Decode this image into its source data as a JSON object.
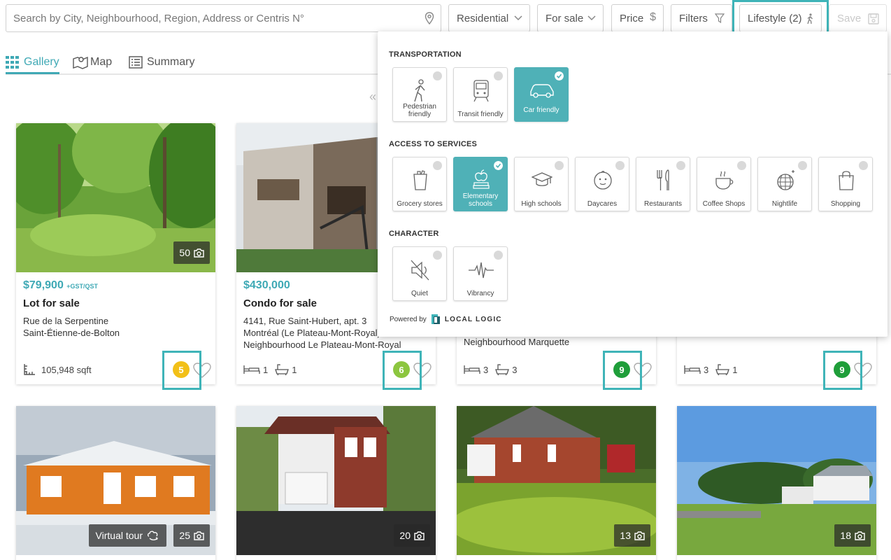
{
  "search": {
    "placeholder": "Search by City, Neighbourhood, Region, Address or Centris N°"
  },
  "filters": {
    "category": "Residential",
    "transaction": "For sale",
    "price": "Price",
    "filters": "Filters",
    "lifestyle": "Lifestyle (2)",
    "save": "Save"
  },
  "tabs": [
    {
      "label": "Gallery",
      "active": true
    },
    {
      "label": "Map",
      "active": false
    },
    {
      "label": "Summary",
      "active": false
    }
  ],
  "lifestyle_panel": {
    "sections": [
      {
        "title": "TRANSPORTATION",
        "options": [
          {
            "label": "Pedestrian friendly",
            "icon": "pedestrian-icon",
            "selected": false
          },
          {
            "label": "Transit friendly",
            "icon": "train-icon",
            "selected": false
          },
          {
            "label": "Car friendly",
            "icon": "car-icon",
            "selected": true
          }
        ]
      },
      {
        "title": "ACCESS TO SERVICES",
        "options": [
          {
            "label": "Grocery stores",
            "icon": "grocery-icon",
            "selected": false
          },
          {
            "label": "Elementary schools",
            "icon": "apple-books-icon",
            "selected": true
          },
          {
            "label": "High schools",
            "icon": "graduation-cap-icon",
            "selected": false
          },
          {
            "label": "Daycares",
            "icon": "baby-face-icon",
            "selected": false
          },
          {
            "label": "Restaurants",
            "icon": "cutlery-icon",
            "selected": false
          },
          {
            "label": "Coffee Shops",
            "icon": "coffee-cup-icon",
            "selected": false
          },
          {
            "label": "Nightlife",
            "icon": "disco-ball-icon",
            "selected": false
          },
          {
            "label": "Shopping",
            "icon": "shopping-bag-icon",
            "selected": false
          }
        ]
      },
      {
        "title": "CHARACTER",
        "options": [
          {
            "label": "Quiet",
            "icon": "muted-speaker-icon",
            "selected": false
          },
          {
            "label": "Vibrancy",
            "icon": "pulse-icon",
            "selected": false
          }
        ]
      }
    ],
    "powered_by": "Powered by",
    "brand": "LOCAL LOGIC"
  },
  "listings": [
    {
      "photos": "50",
      "price": "$79,900",
      "price_suffix": "+GST/QST",
      "type": "Lot for sale",
      "address": [
        "Rue de la Serpentine",
        "Saint-Étienne-de-Bolton"
      ],
      "area": "105,948 sqft",
      "score": "5",
      "score_color": "#f2c018"
    },
    {
      "photos": "",
      "price": "$430,000",
      "price_suffix": "",
      "type": "Condo for sale",
      "address": [
        "4141, Rue Saint-Hubert, apt. 3",
        "Montréal (Le Plateau-Mont-Royal)",
        "Neighbourhood Le Plateau-Mont-Royal"
      ],
      "beds": "1",
      "baths": "1",
      "score": "6",
      "score_color": "#8cc63f"
    },
    {
      "address_tail": "Neighbourhood Marquette",
      "beds": "3",
      "baths": "3",
      "score": "9",
      "score_color": "#1f9e3a"
    },
    {
      "beds": "3",
      "baths": "1",
      "score": "9",
      "score_color": "#1f9e3a"
    },
    {
      "photos": "25",
      "virtual_tour": "Virtual tour"
    },
    {
      "photos": "20"
    },
    {
      "photos": "13"
    },
    {
      "photos": "18"
    }
  ],
  "colors": {
    "accent": "#3fa9b5",
    "highlight": "#3fb4b8",
    "selected_option": "#4fb1b7"
  }
}
